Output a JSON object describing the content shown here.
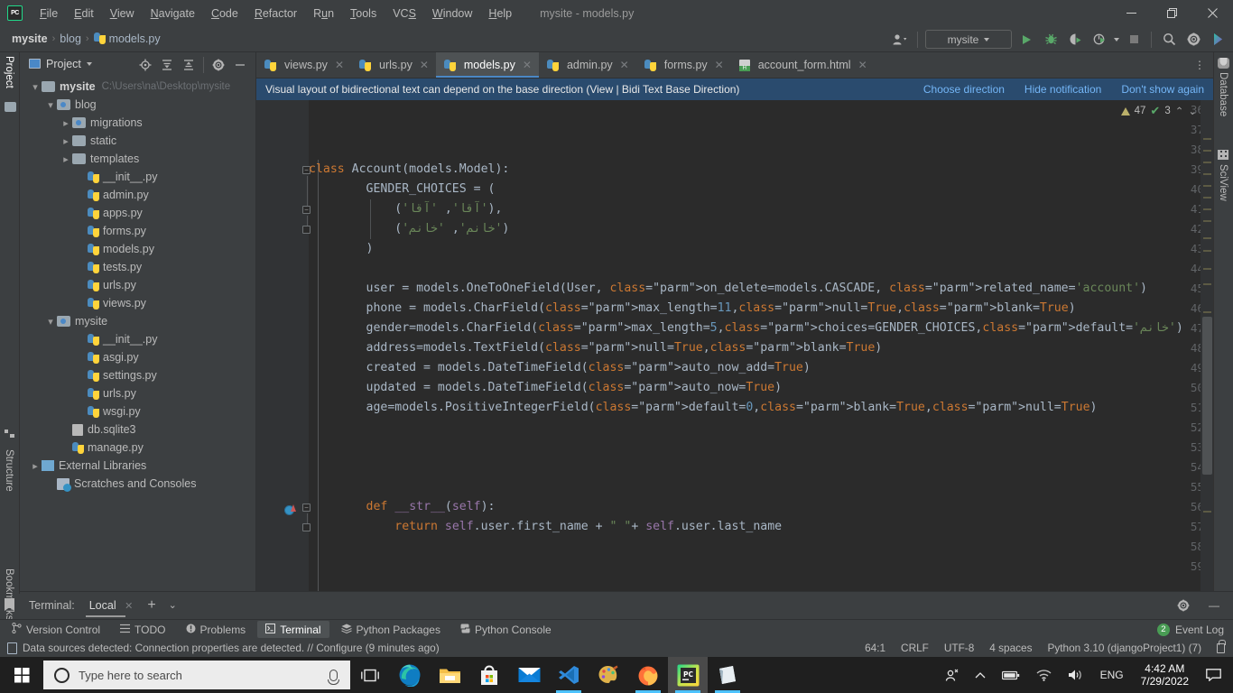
{
  "window": {
    "title": "mysite - models.py",
    "minimize": "—",
    "maximize": "❐",
    "close": "✕"
  },
  "menubar": {
    "items": [
      "File",
      "Edit",
      "View",
      "Navigate",
      "Code",
      "Refactor",
      "Run",
      "Tools",
      "VCS",
      "Window",
      "Help"
    ]
  },
  "breadcrumb": {
    "project": "mysite",
    "folder": "blog",
    "file": "models.py",
    "separator": "›"
  },
  "toolbar": {
    "run_config": "mysite",
    "icons": [
      "user-accounts-icon",
      "run-icon",
      "debug-icon",
      "run-coverage-icon",
      "profile-icon",
      "stop-icon",
      "search-everywhere-icon",
      "settings-icon",
      "ide-assistant-icon"
    ]
  },
  "left_strip": {
    "labels": [
      "Project",
      "Structure",
      "Bookmarks"
    ]
  },
  "right_strip": {
    "labels": [
      "Database",
      "SciView"
    ]
  },
  "project_panel": {
    "title": "Project",
    "tree": [
      {
        "label": "mysite",
        "path": "C:\\Users\\na\\Desktop\\mysite",
        "indent": 0,
        "arrow": "open",
        "icon": "folder",
        "bold": true
      },
      {
        "label": "blog",
        "path": "",
        "indent": 1,
        "arrow": "open",
        "icon": "folder-src",
        "bold": false
      },
      {
        "label": "migrations",
        "path": "",
        "indent": 2,
        "arrow": "closed",
        "icon": "folder-src",
        "bold": false
      },
      {
        "label": "static",
        "path": "",
        "indent": 2,
        "arrow": "closed",
        "icon": "folder",
        "bold": false
      },
      {
        "label": "templates",
        "path": "",
        "indent": 2,
        "arrow": "closed",
        "icon": "folder",
        "bold": false
      },
      {
        "label": "__init__.py",
        "path": "",
        "indent": 3,
        "arrow": "none",
        "icon": "python",
        "bold": false
      },
      {
        "label": "admin.py",
        "path": "",
        "indent": 3,
        "arrow": "none",
        "icon": "python",
        "bold": false
      },
      {
        "label": "apps.py",
        "path": "",
        "indent": 3,
        "arrow": "none",
        "icon": "python",
        "bold": false
      },
      {
        "label": "forms.py",
        "path": "",
        "indent": 3,
        "arrow": "none",
        "icon": "python",
        "bold": false
      },
      {
        "label": "models.py",
        "path": "",
        "indent": 3,
        "arrow": "none",
        "icon": "python",
        "bold": false
      },
      {
        "label": "tests.py",
        "path": "",
        "indent": 3,
        "arrow": "none",
        "icon": "python",
        "bold": false
      },
      {
        "label": "urls.py",
        "path": "",
        "indent": 3,
        "arrow": "none",
        "icon": "python",
        "bold": false
      },
      {
        "label": "views.py",
        "path": "",
        "indent": 3,
        "arrow": "none",
        "icon": "python",
        "bold": false
      },
      {
        "label": "mysite",
        "path": "",
        "indent": 1,
        "arrow": "open",
        "icon": "folder-src",
        "bold": false
      },
      {
        "label": "__init__.py",
        "path": "",
        "indent": 3,
        "arrow": "none",
        "icon": "python",
        "bold": false
      },
      {
        "label": "asgi.py",
        "path": "",
        "indent": 3,
        "arrow": "none",
        "icon": "python",
        "bold": false
      },
      {
        "label": "settings.py",
        "path": "",
        "indent": 3,
        "arrow": "none",
        "icon": "python",
        "bold": false
      },
      {
        "label": "urls.py",
        "path": "",
        "indent": 3,
        "arrow": "none",
        "icon": "python",
        "bold": false
      },
      {
        "label": "wsgi.py",
        "path": "",
        "indent": 3,
        "arrow": "none",
        "icon": "python",
        "bold": false
      },
      {
        "label": "db.sqlite3",
        "path": "",
        "indent": 2,
        "arrow": "none",
        "icon": "database-file",
        "bold": false
      },
      {
        "label": "manage.py",
        "path": "",
        "indent": 2,
        "arrow": "none",
        "icon": "python",
        "bold": false
      },
      {
        "label": "External Libraries",
        "path": "",
        "indent": 0,
        "arrow": "closed",
        "icon": "library",
        "bold": false
      },
      {
        "label": "Scratches and Consoles",
        "path": "",
        "indent": 1,
        "arrow": "none",
        "icon": "scratches",
        "bold": false
      }
    ]
  },
  "editor": {
    "tabs": [
      {
        "label": "views.py",
        "icon": "python",
        "active": false
      },
      {
        "label": "urls.py",
        "icon": "python",
        "active": false
      },
      {
        "label": "models.py",
        "icon": "python",
        "active": true
      },
      {
        "label": "admin.py",
        "icon": "python",
        "active": false
      },
      {
        "label": "forms.py",
        "icon": "python",
        "active": false
      },
      {
        "label": "account_form.html",
        "icon": "html",
        "active": false
      }
    ],
    "banner": {
      "message": "Visual layout of bidirectional text can depend on the base direction (View | Bidi Text Base Direction)",
      "links": [
        "Choose direction",
        "Hide notification",
        "Don't show again"
      ]
    },
    "inspection": {
      "warnings": "47",
      "checks": "3",
      "up": "⌃",
      "down": "⌄"
    },
    "first_line_number": 36,
    "lines": [
      {
        "n": 36,
        "text": ""
      },
      {
        "n": 37,
        "text": ""
      },
      {
        "n": 38,
        "text": ""
      },
      {
        "n": 39,
        "text": "class Account(models.Model):"
      },
      {
        "n": 40,
        "text": "        GENDER_CHOICES = ("
      },
      {
        "n": 41,
        "text": "            ('آقا', 'آقا'),"
      },
      {
        "n": 42,
        "text": "            ('خانم', 'خانم')"
      },
      {
        "n": 43,
        "text": "        )"
      },
      {
        "n": 44,
        "text": ""
      },
      {
        "n": 45,
        "text": "        user = models.OneToOneField(User, on_delete=models.CASCADE, related_name='account')"
      },
      {
        "n": 46,
        "text": "        phone = models.CharField(max_length=11,null=True,blank=True)"
      },
      {
        "n": 47,
        "text": "        gender=models.CharField(max_length=5,choices=GENDER_CHOICES,default='خانم')"
      },
      {
        "n": 48,
        "text": "        address=models.TextField(null=True,blank=True)"
      },
      {
        "n": 49,
        "text": "        created = models.DateTimeField(auto_now_add=True)"
      },
      {
        "n": 50,
        "text": "        updated = models.DateTimeField(auto_now=True)"
      },
      {
        "n": 51,
        "text": "        age=models.PositiveIntegerField(default=0,blank=True,null=True)"
      },
      {
        "n": 52,
        "text": ""
      },
      {
        "n": 53,
        "text": ""
      },
      {
        "n": 54,
        "text": ""
      },
      {
        "n": 55,
        "text": ""
      },
      {
        "n": 56,
        "text": "        def __str__(self):"
      },
      {
        "n": 57,
        "text": "            return self.user.first_name + \" \"+ self.user.last_name"
      },
      {
        "n": 58,
        "text": ""
      },
      {
        "n": 59,
        "text": ""
      }
    ]
  },
  "terminal_panel": {
    "label": "Terminal:",
    "tab": "Local",
    "close": "✕",
    "add": "+",
    "chevron": "⌄",
    "settings_icon": "gear-icon",
    "minimize": "—"
  },
  "bottom_bar": {
    "items": [
      {
        "label": "Version Control",
        "icon": "branch-icon",
        "active": false
      },
      {
        "label": "TODO",
        "icon": "list-icon",
        "active": false
      },
      {
        "label": "Problems",
        "icon": "warning-icon",
        "active": false
      },
      {
        "label": "Terminal",
        "icon": "terminal-icon",
        "active": true
      },
      {
        "label": "Python Packages",
        "icon": "packages-icon",
        "active": false
      },
      {
        "label": "Python Console",
        "icon": "python-icon",
        "active": false
      }
    ],
    "event_log": {
      "label": "Event Log",
      "count": "2"
    }
  },
  "status_bar": {
    "message": "Data sources detected: Connection properties are detected. // Configure (9 minutes ago)",
    "caret": "64:1",
    "line_separator": "CRLF",
    "encoding": "UTF-8",
    "indent": "4 spaces",
    "interpreter": "Python 3.10 (djangoProject1) (7)",
    "lock": "lock-icon"
  },
  "taskbar": {
    "search_placeholder": "Type here to search",
    "apps": [
      {
        "name": "task-view-icon"
      },
      {
        "name": "microsoft-edge-icon"
      },
      {
        "name": "file-explorer-icon"
      },
      {
        "name": "microsoft-store-icon"
      },
      {
        "name": "mail-icon"
      },
      {
        "name": "vscode-icon"
      },
      {
        "name": "paint-icon"
      },
      {
        "name": "firefox-icon"
      },
      {
        "name": "pycharm-icon"
      },
      {
        "name": "notes-icon"
      }
    ],
    "tray": {
      "people": "ඞ",
      "chevron": "⌃",
      "battery": "battery-icon",
      "wifi": "wifi-icon",
      "volume": "volume-icon",
      "language": "ENG",
      "time": "4:42 AM",
      "date": "7/29/2022",
      "notifications": "notification-icon"
    }
  },
  "colors": {
    "accent": "#4a88c7",
    "banner_bg": "#2a4b6e",
    "editor_bg": "#2b2b2b",
    "panel_bg": "#3c3f41",
    "keyword": "#cc7832",
    "string": "#6a8759",
    "number": "#6897bb",
    "function": "#ffc66d",
    "magic": "#9876aa",
    "green_run": "#59a869"
  }
}
